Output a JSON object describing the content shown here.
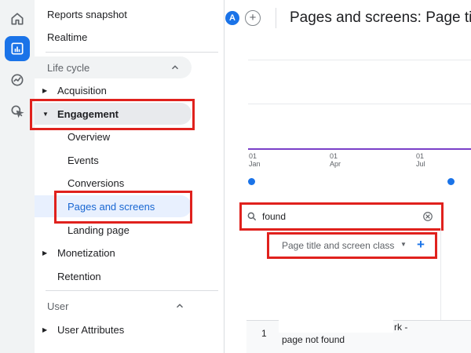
{
  "rail": {
    "icons": [
      "home-icon",
      "reports-icon",
      "explore-icon",
      "advertising-icon"
    ]
  },
  "sidebar": {
    "reports_snapshot": "Reports snapshot",
    "realtime": "Realtime",
    "lifecycle": {
      "title": "Life cycle",
      "acquisition": "Acquisition",
      "engagement": "Engagement",
      "engagement_items": [
        "Overview",
        "Events",
        "Conversions",
        "Pages and screens",
        "Landing page"
      ],
      "monetization": "Monetization",
      "retention": "Retention"
    },
    "user": {
      "title": "User",
      "user_attributes": "User Attributes"
    }
  },
  "header": {
    "avatar_letter": "A",
    "add_symbol": "+",
    "title": "Pages and screens: Page title"
  },
  "chart": {
    "ticks": [
      {
        "day": "01",
        "month": "Jan"
      },
      {
        "day": "01",
        "month": "Apr"
      },
      {
        "day": "01",
        "month": "Jul"
      }
    ],
    "line_color": "#7a3fc8",
    "dot_color": "#1a73e8"
  },
  "search": {
    "value": "found"
  },
  "dimension": {
    "label": "Page title and screen class",
    "add": "+"
  },
  "table": {
    "rows": [
      {
        "index": "1",
        "text_line1": "rk -",
        "text_line2": "page not found"
      }
    ]
  },
  "colors": {
    "accent": "#1a73e8",
    "highlight_box": "#e0211d",
    "selected_bg": "#e8f0fe"
  }
}
